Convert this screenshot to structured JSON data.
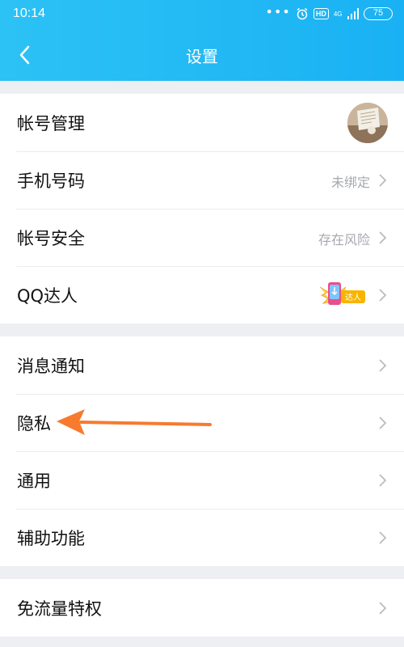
{
  "status_bar": {
    "time": "10:14",
    "network_top": "4G",
    "network_bottom": "",
    "hd_label": "HD",
    "battery": "75"
  },
  "nav": {
    "title": "设置"
  },
  "groups": [
    {
      "rows": [
        {
          "label": "帐号管理",
          "value": ""
        },
        {
          "label": "手机号码",
          "value": "未绑定"
        },
        {
          "label": "帐号安全",
          "value": "存在风险"
        },
        {
          "label": "QQ达人",
          "value": "",
          "badge_text": "达人"
        }
      ]
    },
    {
      "rows": [
        {
          "label": "消息通知"
        },
        {
          "label": "隐私"
        },
        {
          "label": "通用"
        },
        {
          "label": "辅助功能"
        }
      ]
    },
    {
      "rows": [
        {
          "label": "免流量特权"
        }
      ]
    }
  ],
  "colors": {
    "header": "#1ab1f4",
    "annotation_arrow": "#f77a2f"
  }
}
